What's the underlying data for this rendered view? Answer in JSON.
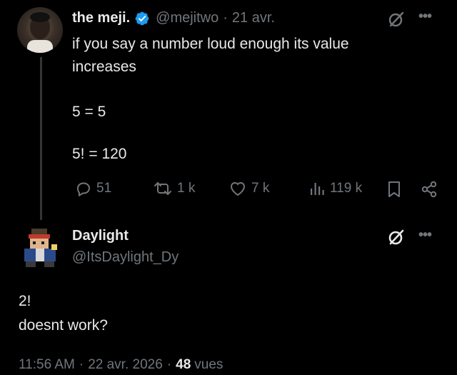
{
  "parent_tweet": {
    "display_name": "the meji.",
    "handle": "@mejitwo",
    "separator": "·",
    "date": "21 avr.",
    "text_lines": [
      "if you say a number loud enough its value",
      "increases"
    ],
    "equation_1": "5 = 5",
    "equation_2": "5! = 120",
    "actions": {
      "replies": "51",
      "reposts": "1 k",
      "likes": "7 k",
      "views": "119 k"
    }
  },
  "reply_tweet": {
    "display_name": "Daylight",
    "handle": "@ItsDaylight_Dy",
    "text_lines": [
      "2!",
      "doesnt work?"
    ],
    "time": "11:56 AM",
    "separator": "·",
    "date": "22 avr. 2026",
    "separator_2": "·",
    "views_count": "48",
    "views_label": "vues"
  },
  "icons": [
    "verified-badge-icon",
    "grok-icon",
    "more-icon",
    "reply-icon",
    "repost-icon",
    "like-icon",
    "views-icon",
    "bookmark-icon",
    "share-icon"
  ],
  "colors": {
    "background": "#000000",
    "text": "#e7e9ea",
    "muted": "#71767b",
    "verified": "#1d9bf0"
  }
}
